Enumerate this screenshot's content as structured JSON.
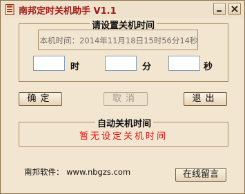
{
  "window": {
    "title": "南邦定时关机助手 V1.1"
  },
  "set_group": {
    "legend": "请设置关机时间",
    "clock_label": "本机时间：",
    "clock_value": "2014年11月18日15时56分14秒",
    "hour_unit": "时",
    "minute_unit": "分",
    "second_unit": "秒",
    "hour_value": "",
    "minute_value": "",
    "second_value": ""
  },
  "buttons": {
    "ok": "确定",
    "cancel": "取消",
    "exit": "退出",
    "message": "在线留言"
  },
  "auto_group": {
    "legend": "自动关机时间",
    "status": "暂无设定关机时间"
  },
  "footer": {
    "label": "南邦软件：",
    "url": "www.nbgzs.com"
  },
  "icons": {
    "app": "app-icon",
    "minimize": "minimize-icon",
    "close": "close-icon"
  },
  "colors": {
    "title": "#a01818",
    "status": "#e01010"
  }
}
